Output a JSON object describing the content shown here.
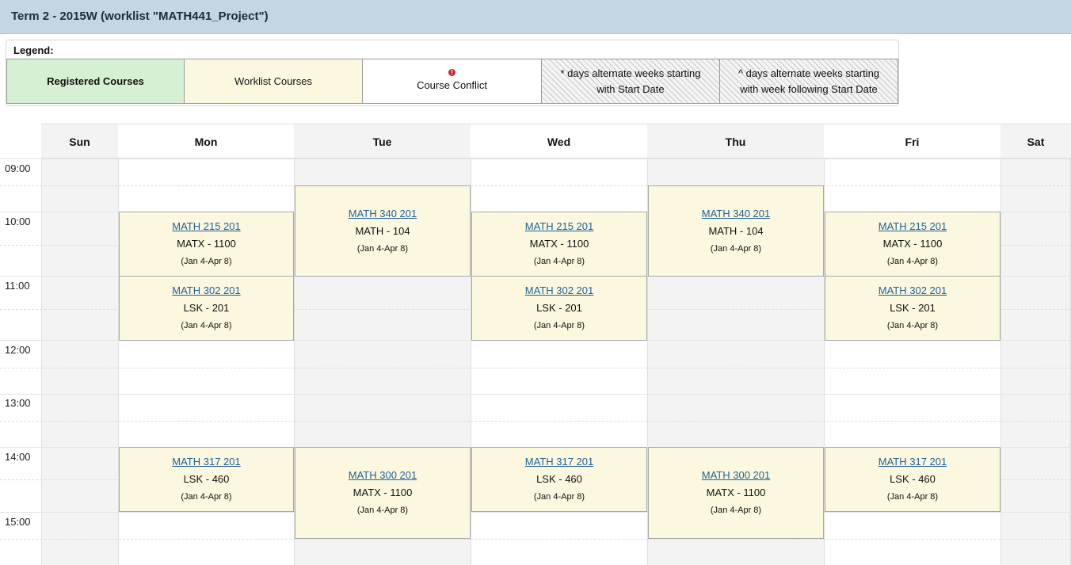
{
  "header": {
    "title": "Term 2 - 2015W (worklist \"MATH441_Project\")"
  },
  "legend": {
    "title": "Legend:",
    "registered": "Registered Courses",
    "worklist": "Worklist Courses",
    "conflict": "Course Conflict",
    "conflict_icon": "!",
    "alt1_line1": "* days alternate weeks starting",
    "alt1_line2": "with Start Date",
    "alt2_line1": "^ days alternate weeks starting",
    "alt2_line2": "with week following Start Date"
  },
  "days": [
    "Sun",
    "Mon",
    "Tue",
    "Wed",
    "Thu",
    "Fri",
    "Sat"
  ],
  "times": [
    "09:00",
    "10:00",
    "11:00",
    "12:00",
    "13:00",
    "14:00",
    "15:00"
  ],
  "events": [
    {
      "code": "MATH 215 201",
      "room": "MATX - 1100",
      "dates": "(Jan 4-Apr 8)"
    },
    {
      "code": "MATH 302 201",
      "room": "LSK - 201",
      "dates": "(Jan 4-Apr 8)"
    },
    {
      "code": "MATH 317 201",
      "room": "LSK - 460",
      "dates": "(Jan 4-Apr 8)"
    },
    {
      "code": "MATH 340 201",
      "room": "MATH - 104",
      "dates": "(Jan 4-Apr 8)"
    },
    {
      "code": "MATH 300 201",
      "room": "MATX - 1100",
      "dates": "(Jan 4-Apr 8)"
    },
    {
      "code": "MATH 215 201",
      "room": "MATX - 1100",
      "dates": "(Jan 4-Apr 8)"
    },
    {
      "code": "MATH 302 201",
      "room": "LSK - 201",
      "dates": "(Jan 4-Apr 8)"
    },
    {
      "code": "MATH 317 201",
      "room": "LSK - 460",
      "dates": "(Jan 4-Apr 8)"
    },
    {
      "code": "MATH 340 201",
      "room": "MATH - 104",
      "dates": "(Jan 4-Apr 8)"
    },
    {
      "code": "MATH 300 201",
      "room": "MATX - 1100",
      "dates": "(Jan 4-Apr 8)"
    },
    {
      "code": "MATH 215 201",
      "room": "MATX - 1100",
      "dates": "(Jan 4-Apr 8)"
    },
    {
      "code": "MATH 302 201",
      "room": "LSK - 201",
      "dates": "(Jan 4-Apr 8)"
    },
    {
      "code": "MATH 317 201",
      "room": "LSK - 460",
      "dates": "(Jan 4-Apr 8)"
    }
  ],
  "colors": {
    "worklist": "#fbf8df",
    "registered": "#d6f0d3",
    "conflict": "#c9262c",
    "link": "#1f5f99",
    "header": "#c6d5e3"
  }
}
